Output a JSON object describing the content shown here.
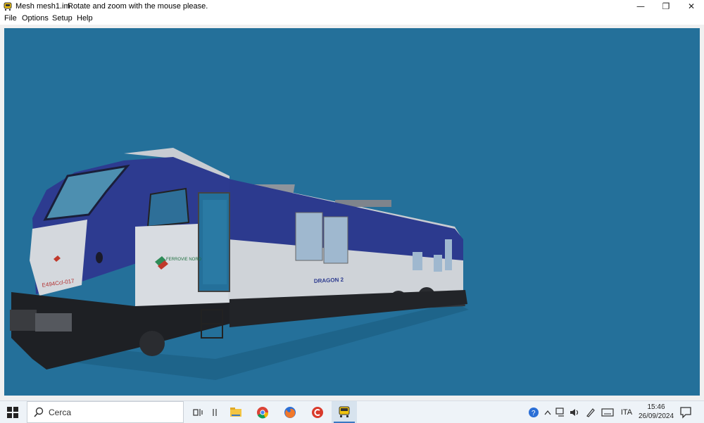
{
  "window": {
    "title": "Mesh mesh1.im",
    "hint": "Rotate and zoom with the mouse please.",
    "controls": {
      "minimize": "—",
      "restore": "❐",
      "close": "✕"
    }
  },
  "menu": {
    "file": "File",
    "options": "Options",
    "setup": "Setup",
    "help": "Help"
  },
  "scene": {
    "background_color": "#24709a",
    "model_texts": {
      "number": "E494Ccl-017",
      "brand": "FERROVIE NORD",
      "model_name": "DRAGON 2"
    }
  },
  "taskbar": {
    "search_placeholder": "Cerca",
    "apps": [
      "task-view-icon",
      "divider-icon",
      "file-explorer-icon",
      "chrome-icon",
      "firefox-icon",
      "ccleaner-icon",
      "mesh-viewer-icon"
    ],
    "tray": {
      "language": "ITA",
      "time": "15:46",
      "date": "26/09/2024"
    }
  }
}
